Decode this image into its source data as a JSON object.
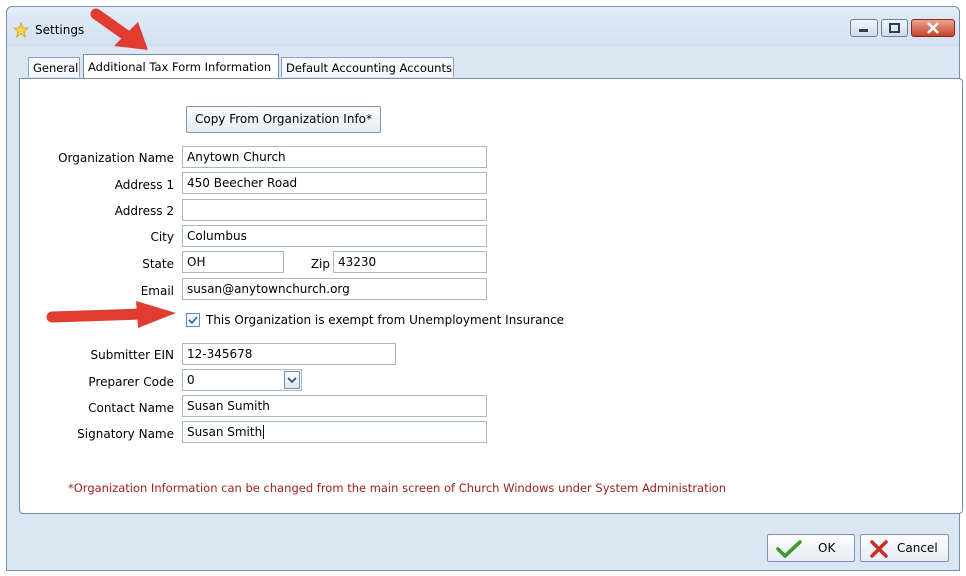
{
  "window": {
    "title": "Settings"
  },
  "tabs": [
    {
      "label": "General"
    },
    {
      "label": "Additional Tax Form Information"
    },
    {
      "label": "Default Accounting Accounts"
    }
  ],
  "form": {
    "copy_button": "Copy From Organization Info*",
    "labels": {
      "org_name": "Organization Name",
      "address1": "Address 1",
      "address2": "Address 2",
      "city": "City",
      "state": "State",
      "zip": "Zip",
      "email": "Email",
      "submitter_ein": "Submitter EIN",
      "preparer_code": "Preparer Code",
      "contact_name": "Contact Name",
      "signatory_name": "Signatory Name"
    },
    "values": {
      "org_name": "Anytown Church",
      "address1": "450 Beecher Road",
      "address2": "",
      "city": "Columbus",
      "state": "OH",
      "zip": "43230",
      "email": "susan@anytownchurch.org",
      "submitter_ein": "12-345678",
      "preparer_code": "0",
      "contact_name": "Susan Sumith",
      "signatory_name": "Susan Smith"
    },
    "exempt_checkbox": {
      "label": "This Organization is exempt from Unemployment Insurance",
      "checked": true
    },
    "note": "*Organization Information can be changed from the main screen of Church Windows under System Administration"
  },
  "buttons": {
    "ok": "OK",
    "cancel": "Cancel"
  },
  "colors": {
    "note_text": "#9b1c1c",
    "annotation_arrow": "#e03c31",
    "ok_check": "#3f9a2c",
    "cancel_x": "#c9302c"
  },
  "icons": [
    "star-icon",
    "minimize-icon",
    "maximize-icon",
    "close-icon",
    "checkmark-icon",
    "x-icon",
    "chevron-down-icon",
    "annotation-arrow"
  ]
}
